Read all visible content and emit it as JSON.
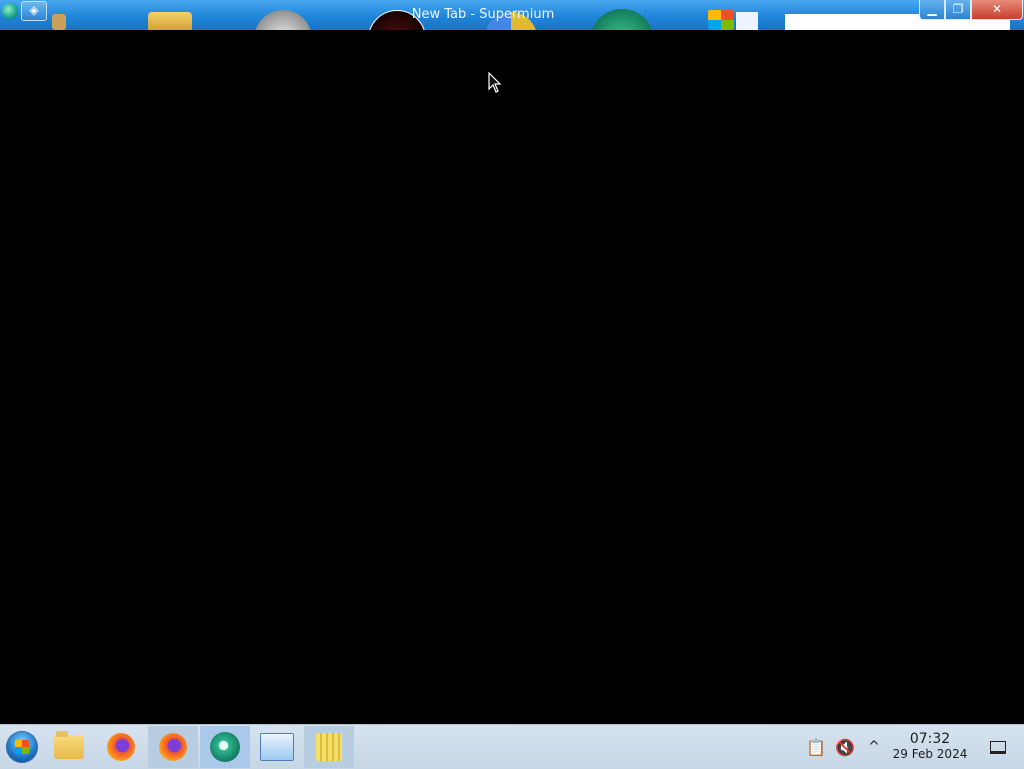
{
  "window": {
    "title": "New Tab - Supermium",
    "menu_icon": "diamond-menu-icon",
    "controls": {
      "minimize": "▁",
      "maximize": "❐",
      "close": "✕"
    }
  },
  "content": {
    "background": "#000000"
  },
  "taskbar": {
    "start": "windows-start-orb-icon",
    "apps": [
      {
        "name": "File Explorer",
        "icon": "folder-icon"
      },
      {
        "name": "Firefox",
        "icon": "firefox-icon"
      },
      {
        "name": "Firefox",
        "icon": "firefox-icon",
        "state": "pressed"
      },
      {
        "name": "Supermium",
        "icon": "supermium-icon",
        "state": "active"
      },
      {
        "name": "Network",
        "icon": "network-icon"
      },
      {
        "name": "Notes",
        "icon": "notes-icon"
      }
    ],
    "tray": {
      "clipboard_icon": "📋",
      "volume_icon": "🔇",
      "chevron": "^",
      "time": "07:32",
      "date": "29 Feb 2024"
    }
  },
  "colors": {
    "titlebar": "#1f86d9",
    "taskbar": "#d0deeb",
    "active_item": "#a9c8ea",
    "close_button": "#c7402a"
  }
}
